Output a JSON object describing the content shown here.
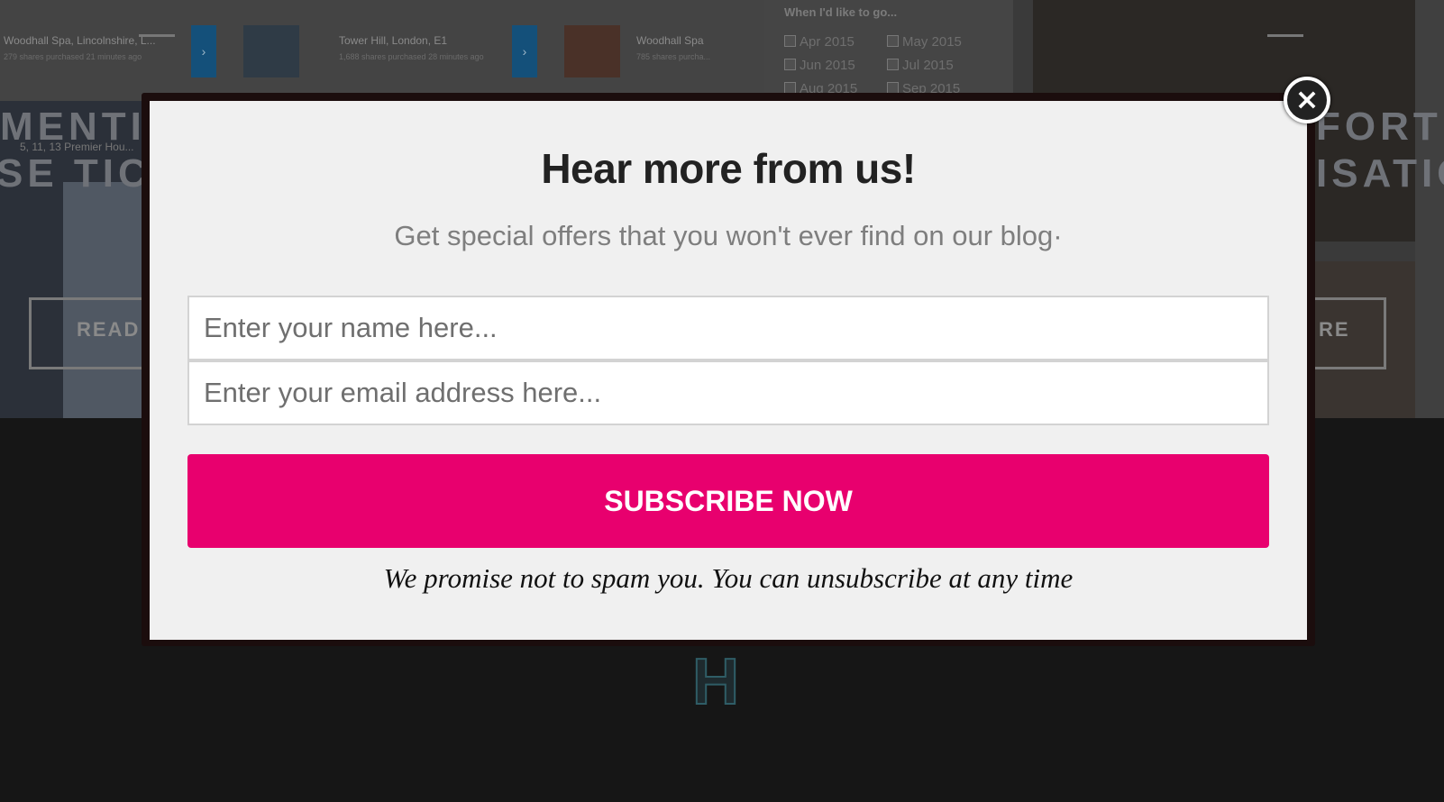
{
  "background": {
    "ticker": [
      {
        "location": "Woodhall Spa, Lincolnshire, L...",
        "detail": "279 shares purchased 21 minutes ago"
      },
      {
        "location": "Tower Hill, London, E1",
        "detail": "1,688 shares purchased 28 minutes ago"
      },
      {
        "location": "Woodhall Spa",
        "detail": "785 shares purcha..."
      }
    ],
    "ticker_arrow": "›",
    "filter": {
      "title": "When I'd like to go...",
      "options": [
        "Apr 2015",
        "May 2015",
        "Jun 2015",
        "Jul 2015",
        "Aug 2015",
        "Sep 2015"
      ]
    },
    "left_heading_1": "MENTIN",
    "left_heading_2": "SE TICK",
    "left_address": "5, 11, 13 Premier Hou...",
    "right_heading_1": "FORT",
    "right_heading_2": "ISATIO",
    "read_button": "READ",
    "read_button_right": "RE",
    "footer_logo": "H"
  },
  "modal": {
    "title": "Hear more from us!",
    "subtitle": "Get special offers that you won't ever find on our blog·",
    "name_placeholder": "Enter your name here...",
    "email_placeholder": "Enter your email address here...",
    "subscribe_label": "SUBSCRIBE NOW",
    "promise": "We promise not to spam you. You can unsubscribe at any time",
    "close_label": "×",
    "accent_color": "#e8006e"
  }
}
